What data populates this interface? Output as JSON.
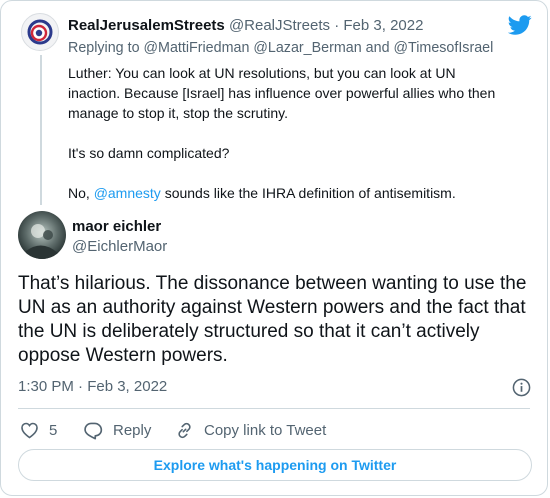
{
  "brand": {
    "icon": "twitter-bird-icon",
    "color": "#1d9bf0"
  },
  "quoted_tweet": {
    "author_name": "RealJerusalemStreets",
    "author_handle": "@RealJStreets",
    "separator": "·",
    "date": "Feb 3, 2022",
    "reply_prefix": "Replying to",
    "reply_handles": [
      "@MattiFriedman",
      "@Lazar_Berman"
    ],
    "reply_and": "and",
    "reply_last": "@TimesofIsrael",
    "para1": "Luther: You can look at UN resolutions, but you can look at UN inaction. Because [Israel] has influence over powerful allies who then manage to stop it, stop the scrutiny.",
    "para2": "It's so damn complicated?",
    "para3_prefix": "No,",
    "para3_mention": "@amnesty",
    "para3_suffix": "sounds like the IHRA definition of antisemitism."
  },
  "tweet": {
    "author_name": "maor eichler",
    "author_handle": "@EichlerMaor",
    "text": "That’s hilarious. The dissonance between wanting to use the UN as an authority against Western powers and the fact that the UN is deliberately structured so that it can’t actively oppose Western powers.",
    "timestamp": "1:30 PM · Feb 3, 2022",
    "info_icon": "info-icon"
  },
  "actions": {
    "like_count": "5",
    "reply_label": "Reply",
    "copy_label": "Copy link to Tweet"
  },
  "explore_label": "Explore what's happening on Twitter"
}
